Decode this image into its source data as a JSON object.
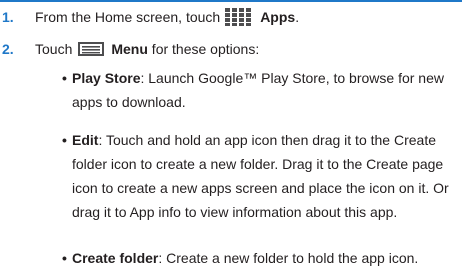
{
  "steps": [
    {
      "number": "1.",
      "before": "From the Home screen, touch",
      "icon": "apps-grid-icon",
      "label": "Apps",
      "after": "."
    },
    {
      "number": "2.",
      "before": "Touch",
      "icon": "menu-icon",
      "label": "Menu",
      "after": " for these options:"
    }
  ],
  "options": [
    {
      "term": "Play Store",
      "desc": ": Launch Google™ Play Store, to browse for new apps to download."
    },
    {
      "term": "Edit",
      "desc": ": Touch and hold an app icon then drag it to the Create folder icon to create a new folder. Drag it to the Create page icon to create a new apps screen and place the icon on it. Or drag it to App info to view information about this app."
    },
    {
      "term": "Create folder",
      "desc": ": Create a new folder to hold the app icon."
    }
  ],
  "colors": {
    "accent": "#1f78c8",
    "text": "#231f20"
  }
}
